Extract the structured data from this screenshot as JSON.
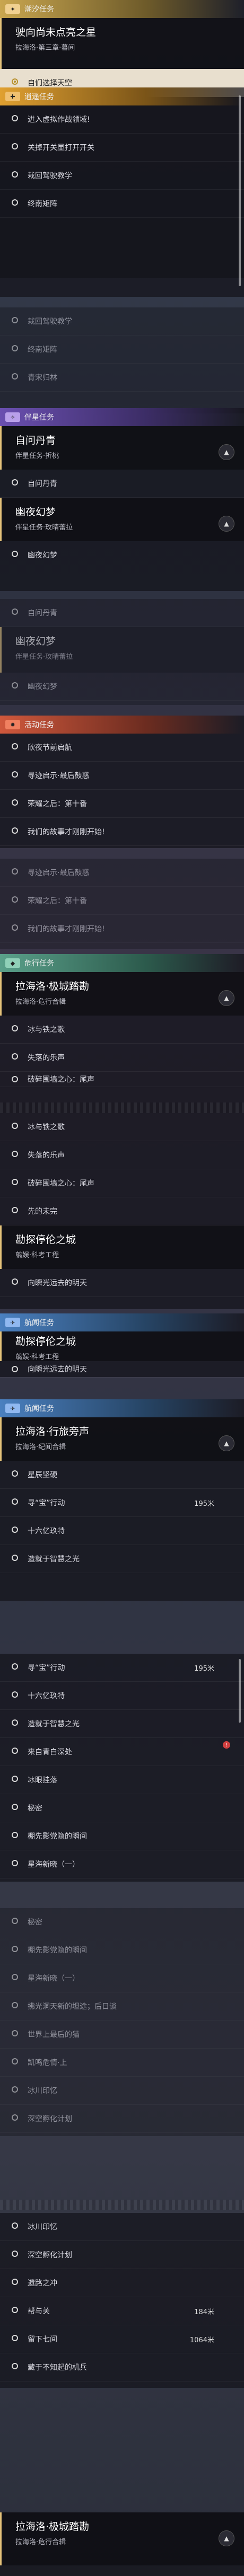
{
  "categories": {
    "main": "潮汐任务",
    "side": "逍遥任务",
    "companion": "伴星任务",
    "event": "活动任务",
    "danger": "危行任务",
    "trail": "航闻任务"
  },
  "quests": {
    "main": {
      "title": "驶向尚未点亮之星",
      "subtitle": "拉海洛·第三章·暮间"
    },
    "companion_a": {
      "title": "自问丹青",
      "subtitle": "伴星任务·折桃"
    },
    "companion_b": {
      "title": "幽夜幻梦",
      "subtitle": "伴星任务·玫晴蕾拉"
    },
    "danger_a": {
      "title": "拉海洛·极城踏勘",
      "subtitle": "拉海洛·危行合辑"
    },
    "danger_b": {
      "title": "勘探停伦之城",
      "subtitle": "翦娱·科考工程"
    },
    "trail_a": {
      "title": "拉海洛·行旅旁声",
      "subtitle": "拉海洛·纪闻合辑"
    },
    "final": {
      "title": "拉海洛·极城踏勘",
      "subtitle": "拉海洛·危行合辑"
    }
  },
  "steps": {
    "main_active": "自们选择天空",
    "side": [
      "进入虚拟作战领域!",
      "关掉开关显打开开关",
      "栽回驾驶教学",
      "终南矩阵"
    ],
    "side_repeat": [
      "栽回驾驶教学",
      "终南矩阵",
      "青宋归林"
    ],
    "comp_a": [
      "自问丹青"
    ],
    "comp_b": [
      "幽夜幻梦"
    ],
    "comp_repeat_a": [
      "自问丹青"
    ],
    "comp_repeat_b": [
      "幽夜幻梦"
    ],
    "event": [
      "欣夜节前启航",
      "寻迹启示·最后鼓惑",
      "荣耀之后：第十番",
      "我们的故事才刚刚开始!"
    ],
    "event_repeat": [
      "寻迹启示·最后鼓惑",
      "荣耀之后：第十番",
      "我们的故事才刚刚开始!"
    ],
    "danger_a": [
      "冰与铁之歌",
      "失落的乐声",
      "破碎围墙之心：尾声"
    ],
    "danger_repeat": [
      "冰与铁之歌",
      "失落的乐声",
      "破碎围墙之心：尾声",
      "先的未完"
    ],
    "danger_b": [
      "向瞬光远去的明天"
    ],
    "danger_b_repeat": [
      "向瞬光远去的明天"
    ],
    "trail_a": [
      "星辰坚硬",
      "寻“宝”行动",
      "十六亿玖特",
      "造就于智慧之光"
    ],
    "trail_a_dist": "195米",
    "trail_more": [
      "寻“宝”行动",
      "十六亿玖特",
      "造就于智慧之光",
      "来自青白深处",
      "冰眼挂落",
      "秘密",
      "棚先影党隐的瞬间",
      "星海新晓（一）"
    ],
    "trail_more_dist": "195米",
    "trail_tail": [
      "秘密",
      "棚先影党隐的瞬间",
      "星海新晓（一）",
      "拂光洞天新的坦途；后日谈",
      "世界上最后的猫",
      "凯鸣危情·上",
      "冰川印忆",
      "深空孵化计划"
    ],
    "trail_end": [
      "冰川印忆",
      "深空孵化计划",
      "遗路之冲",
      "帮与关",
      "留下七间",
      "藏于不知起的机兵"
    ],
    "trail_end_dist_a": "184米",
    "trail_end_dist_b": "1064米"
  },
  "colors": {
    "accent_main": "#c9a64f",
    "accent_active_bg": "#faf0dc"
  }
}
